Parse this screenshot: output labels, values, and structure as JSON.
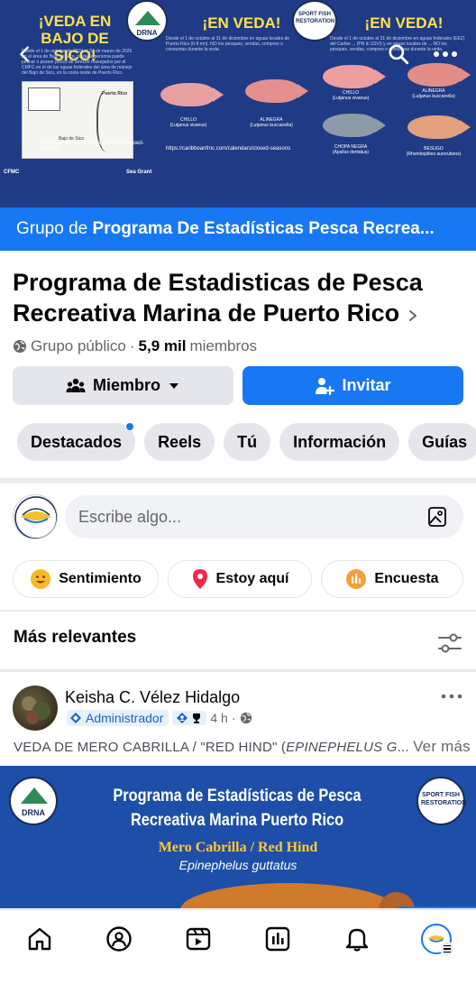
{
  "cover": {
    "panel1_title": "¡VEDA EN BAJO DE SICO!",
    "panel1_text": "Desde el 1 de octubre de 2024 al 31 de marzo de 2025 en el área de Bajo de Sico, ninguna persona puede pescar o poseer peces de arrecife manejados por el CMFC en el de las aguas federales del área de manejo del Bajo de Sico, en la costa oeste de Puerto Rico.",
    "map_label": "Puerto Rico",
    "map_sublabel": "Bajo de Sico",
    "panel2_title": "¡EN VEDA!",
    "panel2_text": "Desde el 1 de octubre al 31 de diciembre en aguas locales de Puerto Rico (0-9 mn). NO los pesques, vendas, compres o consumas durante la veda.",
    "fish_chillo": "CHILLO",
    "fish_chillo_sci": "(Lutjanus vivanus)",
    "fish_alinegra": "ALINEGRA",
    "fish_alinegra_sci": "(Lutjanus buccanella)",
    "panel3_title": "¡EN VEDA!",
    "panel3_text": "Desde el 1 de octubre al 31 de diciembre en aguas federales (EEZ) del Caribe ... (PR & USVI) y en aguas locales de ... NO los pesques, vendas, compres o consumas durante la veda.",
    "fish_chillo3": "CHILLO",
    "fish_chillo3_sci": "(Lutjanus vivanus)",
    "fish_alinegra3": "ALINEGRA",
    "fish_alinegra3_sci": "(Lutjanus buccanella)",
    "fish_chopa": "CHOPA NEGRA",
    "fish_chopa_sci": "(Apsilus dentatus)",
    "fish_besugo": "BESUGO",
    "fish_besugo_sci": "(Rhomboplites aurorubens)",
    "url_text": "https://caribbeanfmc.com/calendars/closed-seasons",
    "logo_drna": "DRNA",
    "logo_sfr": "SPORT FISH RESTORATION",
    "logo_seagrant": "Sea Grant",
    "logo_cfmc": "CFMC"
  },
  "group_banner": {
    "prefix": "Grupo de",
    "name": "Programa De Estadísticas Pesca Recrea..."
  },
  "group": {
    "title": "Programa de Estadisticas de Pesca Recreativa Marina de Puerto Rico",
    "privacy": "Grupo público",
    "separator": "·",
    "member_count": "5,9 mil",
    "members_label": "miembros"
  },
  "buttons": {
    "member": "Miembro",
    "invite": "Invitar"
  },
  "tabs": [
    {
      "label": "Destacados",
      "has_dot": true
    },
    {
      "label": "Reels"
    },
    {
      "label": "Tú"
    },
    {
      "label": "Información"
    },
    {
      "label": "Guías"
    }
  ],
  "composer": {
    "placeholder": "Escribe algo...",
    "avatar_text": "CFMC"
  },
  "actions": {
    "feeling": "Sentimiento",
    "checkin": "Estoy aquí",
    "poll": "Encuesta"
  },
  "sort": {
    "label": "Más relevantes"
  },
  "post": {
    "author": "Keisha C. Vélez Hidalgo",
    "role": "Administrador",
    "time": "4 h",
    "dot": "·",
    "text_start": "VEDA DE MERO CABRILLA / \"RED HIND\" (",
    "text_italic": "EPINEPHELUS G",
    "text_ellipsis": "...",
    "see_more": "Ver más",
    "image_title": "Programa de Estadísticas de Pesca Recreativa Marina Puerto Rico",
    "image_subtitle": "Mero Cabrilla / Red Hind",
    "image_species": "Epinephelus guttatus",
    "image_logo_left": "DRNA",
    "image_logo_right": "SPORT FISH RESTORATION"
  },
  "nav": {
    "items": [
      "home-icon",
      "groups-icon",
      "video-icon",
      "feeds-icon",
      "notifications-icon",
      "menu-profile-icon"
    ]
  },
  "colors": {
    "accent": "#1877f2",
    "cover_bg": "#1f3b85",
    "cover_title": "#ffe14a",
    "chip_bg": "#e4e6eb",
    "text_secondary": "#65676b"
  }
}
